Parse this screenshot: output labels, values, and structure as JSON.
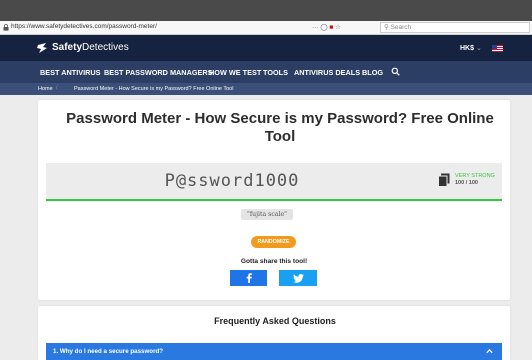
{
  "browser": {
    "url": "https://www.safetydetectives.com/password-meter/",
    "toolbar_icons": [
      "more-dots-icon",
      "pocket-icon",
      "flag-icon",
      "bookmark-star-icon"
    ],
    "search_placeholder": "Search"
  },
  "header": {
    "logo_bold": "Safety",
    "logo_light": "Detectives",
    "currency": "HK$",
    "currency_icon": "chevron-down-icon",
    "language_flag": "us-flag-icon"
  },
  "nav": {
    "items": [
      "BEST ANTIVIRUS",
      "BEST PASSWORD MANAGERS",
      "HOW WE TEST",
      "TOOLS",
      "ANTIVIRUS DEALS",
      "BLOG"
    ],
    "search_icon": "search-icon"
  },
  "breadcrumb": {
    "home": "Home",
    "current": "Password Meter - How Secure is my Password? Free Online Tool"
  },
  "main": {
    "title": "Password Meter - How Secure is my Password? Free Online Tool",
    "password_value": "P@ssword1000",
    "strength_label": "VERY STRONG",
    "score_text": "100 / 100",
    "score": 100,
    "phrase": "\"fujita scale\"",
    "randomize_label": "RANDOMIZE",
    "share_label": "Gotta share this tool!",
    "share_facebook_icon": "facebook-icon",
    "share_twitter_icon": "twitter-icon"
  },
  "faq": {
    "title": "Frequently Asked Questions",
    "items": [
      {
        "question": "1. Why do I need a secure password?"
      }
    ]
  },
  "colors": {
    "header_bg": "#152240",
    "nav_bg": "#2c3e64",
    "breadcrumb_bg": "#3c4f78",
    "strength_green": "#39c441",
    "randomize_orange": "#f39a1c",
    "facebook_blue": "#1f74e8",
    "twitter_blue": "#1aa0f3",
    "faq_blue": "#2a79e0"
  }
}
